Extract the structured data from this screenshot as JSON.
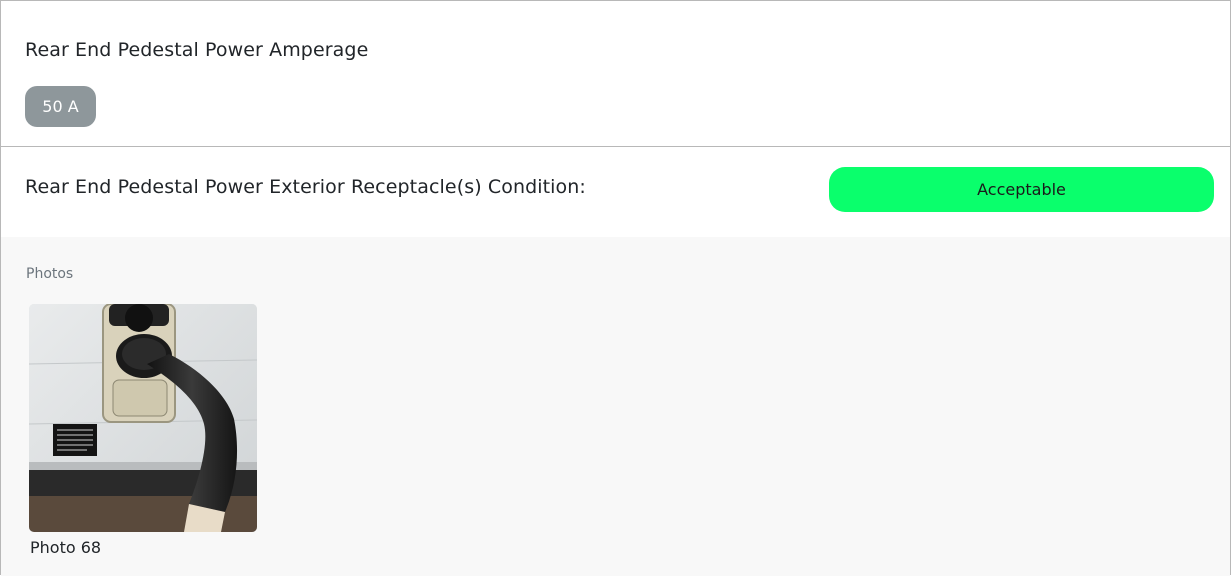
{
  "amperage": {
    "title": "Rear End Pedestal Power Amperage",
    "value": "50 A"
  },
  "condition": {
    "title": "Rear End Pedestal Power Exterior Receptacle(s) Condition:",
    "status": "Acceptable",
    "status_color": "#0aff6c"
  },
  "photos": {
    "label": "Photos",
    "items": [
      {
        "caption": "Photo 68"
      }
    ]
  }
}
